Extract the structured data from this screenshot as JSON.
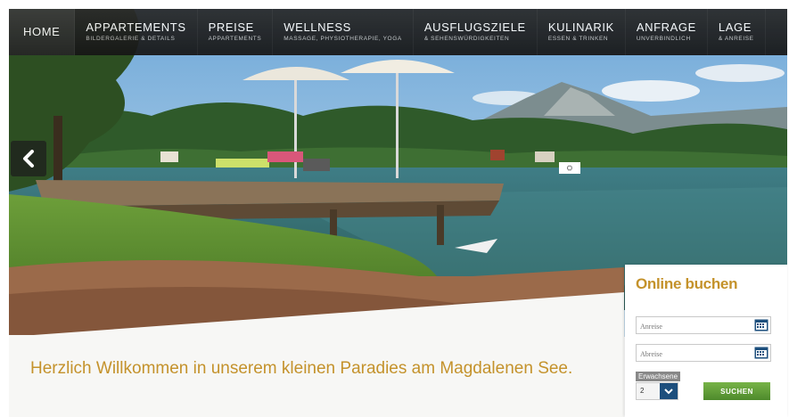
{
  "nav": {
    "items": [
      {
        "label": "HOME",
        "sub": "",
        "active": true
      },
      {
        "label": "APPARTEMENTS",
        "sub": "BILDERGALERIE & DETAILS"
      },
      {
        "label": "PREISE",
        "sub": "APPARTEMENTS"
      },
      {
        "label": "WELLNESS",
        "sub": "MASSAGE, PHYSIOTHERAPIE, YOGA"
      },
      {
        "label": "AUSFLUGSZIELE",
        "sub": "& SEHENSWÜRDIGKEITEN"
      },
      {
        "label": "KULINARIK",
        "sub": "ESSEN & TRINKEN"
      },
      {
        "label": "ANFRAGE",
        "sub": "UNVERBINDLICH"
      },
      {
        "label": "LAGE",
        "sub": "& ANREISE"
      }
    ]
  },
  "welcome": "Herzlich Willkommen in unserem kleinen Paradies am Magdalenen See.",
  "booking": {
    "title": "Online buchen",
    "arrival_placeholder": "Anreise",
    "departure_placeholder": "Abreise",
    "adults_label": "Erwachsene",
    "adults_value": "2",
    "search_label": "SUCHEN"
  },
  "colors": {
    "accent": "#c4922b",
    "nav_bg": "#1f1f1f",
    "search_btn": "#5e9b36",
    "select_btn": "#1d4f7d"
  },
  "icons": [
    "chevron-left-icon",
    "calendar-icon",
    "chevron-down-icon"
  ]
}
